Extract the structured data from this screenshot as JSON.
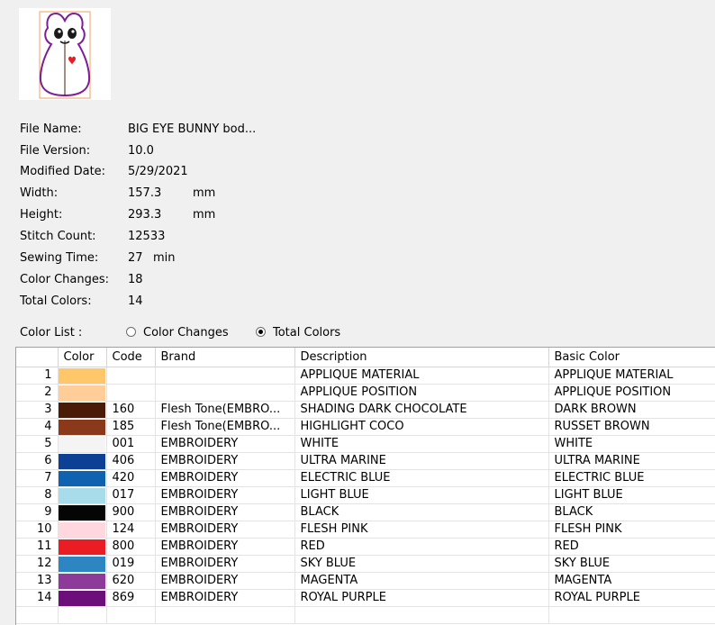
{
  "info": {
    "rows": [
      {
        "label": "File Name:",
        "value": "BIG EYE BUNNY bod...",
        "unit": ""
      },
      {
        "label": "File Version:",
        "value": "10.0",
        "unit": ""
      },
      {
        "label": "Modified Date:",
        "value": "5/29/2021",
        "unit": ""
      },
      {
        "label": "Width:",
        "value": "157.3",
        "unit": "mm"
      },
      {
        "label": "Height:",
        "value": "293.3",
        "unit": "mm"
      },
      {
        "label": "Stitch Count:",
        "value": "12533",
        "unit": ""
      },
      {
        "label": "Sewing Time:",
        "value": "27",
        "unit": "min"
      },
      {
        "label": "Color Changes:",
        "value": "18",
        "unit": ""
      },
      {
        "label": "Total Colors:",
        "value": "14",
        "unit": ""
      }
    ]
  },
  "color_list": {
    "label": "Color List :",
    "options": [
      {
        "label": "Color Changes",
        "checked": false
      },
      {
        "label": "Total Colors",
        "checked": true
      }
    ]
  },
  "table": {
    "headers": [
      "",
      "Color",
      "Code",
      "Brand",
      "Description",
      "Basic Color"
    ],
    "rows": [
      {
        "num": "1",
        "color": "#ffc76a",
        "code": "",
        "brand": "",
        "description": "APPLIQUE MATERIAL",
        "basic": "APPLIQUE MATERIAL"
      },
      {
        "num": "2",
        "color": "#ffcd98",
        "code": "",
        "brand": "",
        "description": "APPLIQUE POSITION",
        "basic": "APPLIQUE POSITION"
      },
      {
        "num": "3",
        "color": "#4a1c08",
        "code": "160",
        "brand": "Flesh Tone(EMBRO...",
        "description": "SHADING DARK CHOCOLATE",
        "basic": "DARK BROWN"
      },
      {
        "num": "4",
        "color": "#8a3a1a",
        "code": "185",
        "brand": "Flesh Tone(EMBRO...",
        "description": "HIGHLIGHT COCO",
        "basic": "RUSSET BROWN"
      },
      {
        "num": "5",
        "color": "#f4f4f4",
        "code": "001",
        "brand": "EMBROIDERY",
        "description": "WHITE",
        "basic": "WHITE"
      },
      {
        "num": "6",
        "color": "#0d3f94",
        "code": "406",
        "brand": "EMBROIDERY",
        "description": "ULTRA MARINE",
        "basic": "ULTRA MARINE"
      },
      {
        "num": "7",
        "color": "#0f62b0",
        "code": "420",
        "brand": "EMBROIDERY",
        "description": "ELECTRIC BLUE",
        "basic": "ELECTRIC BLUE"
      },
      {
        "num": "8",
        "color": "#a9dcea",
        "code": "017",
        "brand": "EMBROIDERY",
        "description": "LIGHT BLUE",
        "basic": "LIGHT BLUE"
      },
      {
        "num": "9",
        "color": "#050505",
        "code": "900",
        "brand": "EMBROIDERY",
        "description": "BLACK",
        "basic": "BLACK"
      },
      {
        "num": "10",
        "color": "#ffd7de",
        "code": "124",
        "brand": "EMBROIDERY",
        "description": "FLESH PINK",
        "basic": "FLESH PINK"
      },
      {
        "num": "11",
        "color": "#ea1c24",
        "code": "800",
        "brand": "EMBROIDERY",
        "description": "RED",
        "basic": "RED"
      },
      {
        "num": "12",
        "color": "#2d86c2",
        "code": "019",
        "brand": "EMBROIDERY",
        "description": "SKY BLUE",
        "basic": "SKY BLUE"
      },
      {
        "num": "13",
        "color": "#8e3a9b",
        "code": "620",
        "brand": "EMBROIDERY",
        "description": "MAGENTA",
        "basic": "MAGENTA"
      },
      {
        "num": "14",
        "color": "#6d0f7a",
        "code": "869",
        "brand": "EMBROIDERY",
        "description": "ROYAL PURPLE",
        "basic": "ROYAL PURPLE"
      }
    ]
  }
}
